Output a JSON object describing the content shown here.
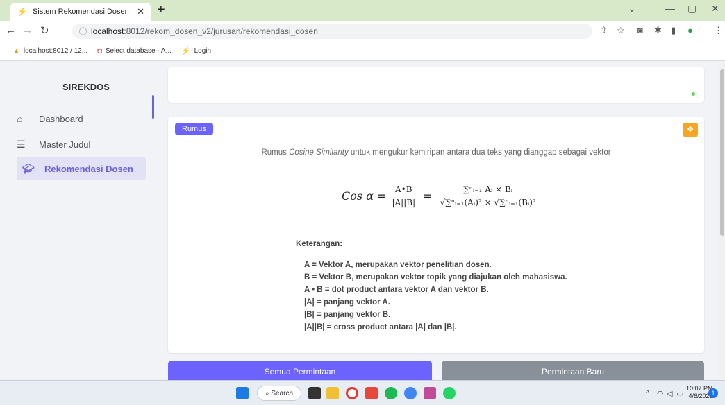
{
  "browser": {
    "tab_title": "Sistem Rekomendasi Dosen",
    "url_host": "localhost",
    "url_rest": ":8012/rekom_dosen_v2/jurusan/rekomendasi_dosen",
    "bookmarks": [
      "localhost:8012 / 12...",
      "Select database - A...",
      "Login"
    ]
  },
  "sidebar": {
    "brand": "SIREKDOS",
    "items": [
      {
        "label": "Dashboard",
        "icon": "home-icon"
      },
      {
        "label": "Master Judul",
        "icon": "list-icon"
      },
      {
        "label": "Rekomendasi Dosen",
        "icon": "graduation-cap-icon"
      }
    ]
  },
  "main": {
    "badge": "Rumus",
    "subtitle_pre": "Rumus ",
    "subtitle_em": "Cosine Similarity",
    "subtitle_post": " untuk mengukur kemiripan antara dua teks yang dianggap sebagai vektor",
    "formula": {
      "lhs": "Cos α =",
      "frac1_num": "A•B",
      "frac1_den": "|A||B|",
      "frac2_num": "∑ⁿᵢ₌₁ Aᵢ × Bᵢ",
      "frac2_den": "√∑ⁿᵢ₌₁(Aᵢ)² × √∑ⁿᵢ₌₁(Bᵢ)²"
    },
    "keterangan_title": "Keterangan:",
    "keterangan": [
      "A = Vektor A, merupakan vektor penelitian dosen.",
      "B = Vektor B, merupakan vektor topik yang diajukan oleh mahasiswa.",
      "A • B = dot product antara vektor A dan vektor B.",
      "|A| = panjang vektor A.",
      "|B| = panjang vektor B.",
      "|A||B| = cross product antara |A| dan |B|."
    ],
    "tab_all": "Semua Permintaan",
    "tab_new": "Permintaan Baru"
  },
  "taskbar": {
    "search": "Search",
    "time": "10:07 PM",
    "date": "4/6/2023",
    "notifications": "1"
  }
}
